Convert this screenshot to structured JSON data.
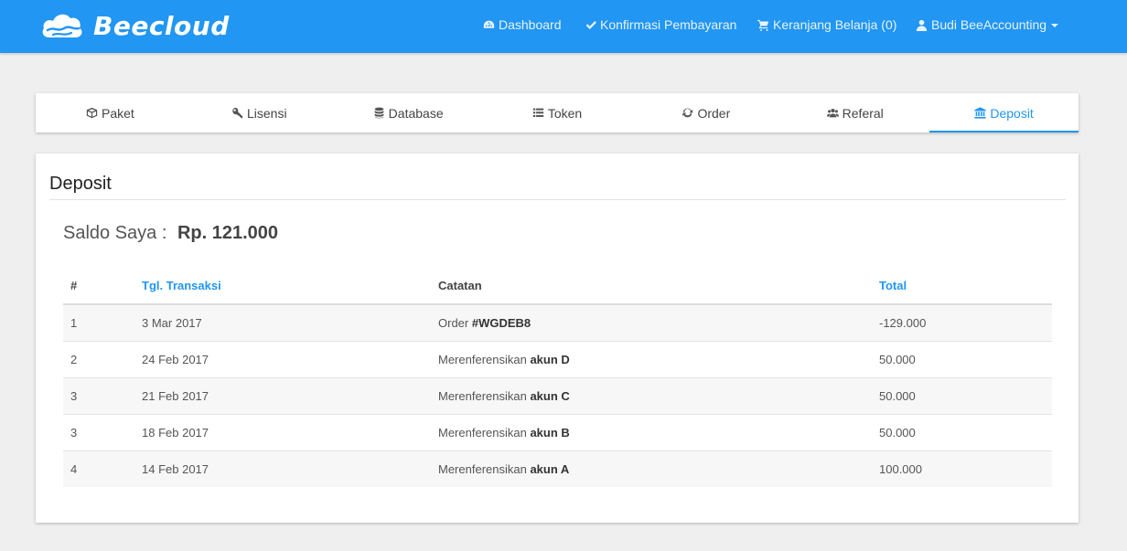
{
  "brand": {
    "name": "Beecloud"
  },
  "nav": {
    "dashboard": "Dashboard",
    "konfirmasi": "Konfirmasi Pembayaran",
    "keranjang": "Keranjang Belanja (0)",
    "user": "Budi BeeAccounting"
  },
  "tabs": [
    {
      "label": "Paket",
      "icon": "cube-icon"
    },
    {
      "label": "Lisensi",
      "icon": "key-icon"
    },
    {
      "label": "Database",
      "icon": "database-icon"
    },
    {
      "label": "Token",
      "icon": "list-icon"
    },
    {
      "label": "Order",
      "icon": "refresh-icon"
    },
    {
      "label": "Referal",
      "icon": "users-icon"
    },
    {
      "label": "Deposit",
      "icon": "bank-icon",
      "active": true
    }
  ],
  "panel": {
    "title": "Deposit",
    "saldo_label": "Saldo Saya :",
    "saldo_amount": "Rp. 121.000"
  },
  "table": {
    "headers": [
      "#",
      "Tgl. Transaksi",
      "Catatan",
      "Total"
    ],
    "rows": [
      {
        "no": "1",
        "date": "3 Mar 2017",
        "note_prefix": "Order ",
        "note_bold": "#WGDEB8",
        "total": "-129.000"
      },
      {
        "no": "2",
        "date": "24 Feb 2017",
        "note_prefix": "Merenferensikan ",
        "note_bold": "akun D",
        "total": "50.000"
      },
      {
        "no": "3",
        "date": "21 Feb 2017",
        "note_prefix": "Merenferensikan ",
        "note_bold": "akun C",
        "total": "50.000"
      },
      {
        "no": "3",
        "date": "18 Feb 2017",
        "note_prefix": "Merenferensikan ",
        "note_bold": "akun B",
        "total": "50.000"
      },
      {
        "no": "4",
        "date": "14 Feb 2017",
        "note_prefix": "Merenferensikan ",
        "note_bold": "akun A",
        "total": "100.000"
      }
    ]
  },
  "colors": {
    "accent": "#2196f3",
    "background": "#efefef"
  }
}
